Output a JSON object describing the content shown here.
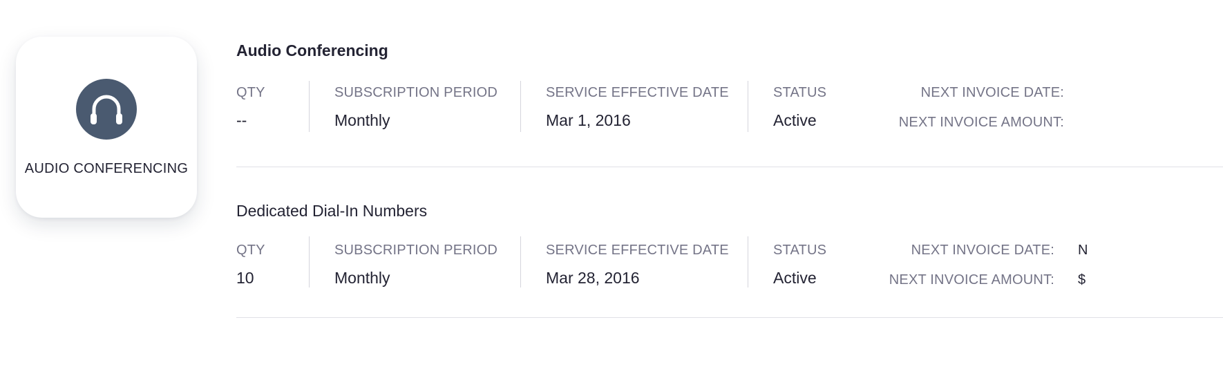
{
  "product": {
    "name": "AUDIO CONFERENCING",
    "icon": "headphones-icon",
    "icon_bg": "#4a5a70"
  },
  "columns": {
    "qty": "QTY",
    "period": "SUBSCRIPTION PERIOD",
    "effective": "SERVICE EFFECTIVE DATE",
    "status": "STATUS",
    "next_date": "NEXT INVOICE DATE:",
    "next_amount": "NEXT INVOICE AMOUNT:"
  },
  "subscriptions": [
    {
      "title": "Audio Conferencing",
      "qty": "--",
      "period": "Monthly",
      "effective_date": "Mar 1, 2016",
      "status": "Active",
      "next_invoice_date": "",
      "next_invoice_amount": ""
    },
    {
      "title": "Dedicated Dial-In Numbers",
      "qty": "10",
      "period": "Monthly",
      "effective_date": "Mar 28, 2016",
      "status": "Active",
      "next_invoice_date": "N",
      "next_invoice_amount": "$"
    }
  ]
}
